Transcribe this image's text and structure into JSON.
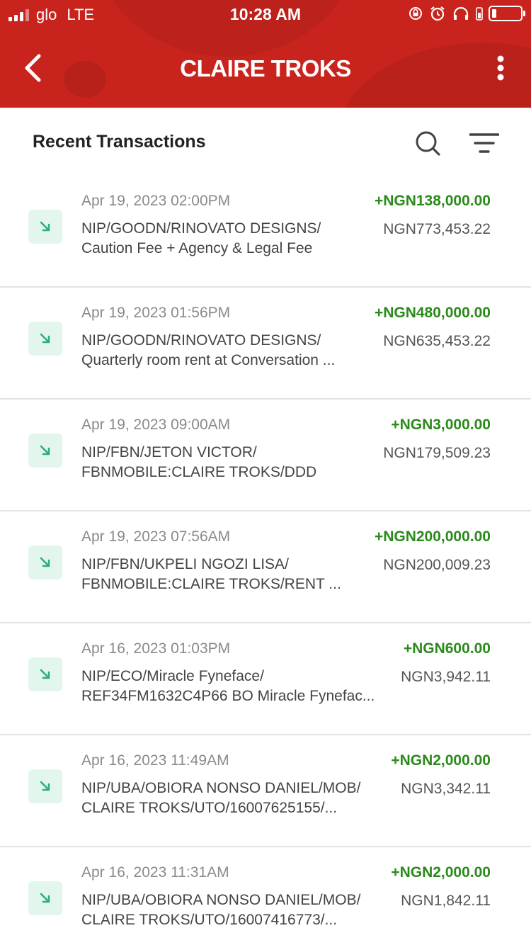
{
  "status_bar": {
    "carrier": "glo",
    "network": "LTE",
    "time": "10:28 AM"
  },
  "header": {
    "title": "CLAIRE TROKS",
    "brand_color": "#c8241d"
  },
  "section": {
    "title": "Recent Transactions"
  },
  "colors": {
    "credit_amount": "#2a8a1a",
    "credit_icon_bg": "#e3f6ee",
    "credit_icon": "#2fae78"
  },
  "transactions": [
    {
      "date": "Apr 19, 2023 02:00PM",
      "line1": "NIP/GOODN/RINOVATO DESIGNS/",
      "line2": "Caution Fee + Agency & Legal Fee",
      "amount": "+NGN138,000.00",
      "balance": "NGN773,453.22"
    },
    {
      "date": "Apr 19, 2023 01:56PM",
      "line1": "NIP/GOODN/RINOVATO DESIGNS/",
      "line2": "Quarterly room rent at Conversation ...",
      "amount": "+NGN480,000.00",
      "balance": "NGN635,453.22"
    },
    {
      "date": "Apr 19, 2023 09:00AM",
      "line1": "NIP/FBN/JETON VICTOR/",
      "line2": "FBNMOBILE:CLAIRE TROKS/DDD",
      "amount": "+NGN3,000.00",
      "balance": "NGN179,509.23"
    },
    {
      "date": "Apr 19, 2023 07:56AM",
      "line1": "NIP/FBN/UKPELI NGOZI LISA/",
      "line2": "FBNMOBILE:CLAIRE TROKS/RENT ...",
      "amount": "+NGN200,000.00",
      "balance": "NGN200,009.23"
    },
    {
      "date": "Apr 16, 2023 01:03PM",
      "line1": "NIP/ECO/Miracle Fyneface/",
      "line2": "REF34FM1632C4P66 BO Miracle Fynefac...",
      "amount": "+NGN600.00",
      "balance": "NGN3,942.11"
    },
    {
      "date": "Apr 16, 2023 11:49AM",
      "line1": "NIP/UBA/OBIORA  NONSO DANIEL/MOB/",
      "line2": "CLAIRE TROKS/UTO/16007625155/...",
      "amount": "+NGN2,000.00",
      "balance": "NGN3,342.11"
    },
    {
      "date": "Apr 16, 2023 11:31AM",
      "line1": "NIP/UBA/OBIORA  NONSO DANIEL/MOB/",
      "line2": "CLAIRE TROKS/UTO/16007416773/...",
      "amount": "+NGN2,000.00",
      "balance": "NGN1,842.11"
    }
  ]
}
